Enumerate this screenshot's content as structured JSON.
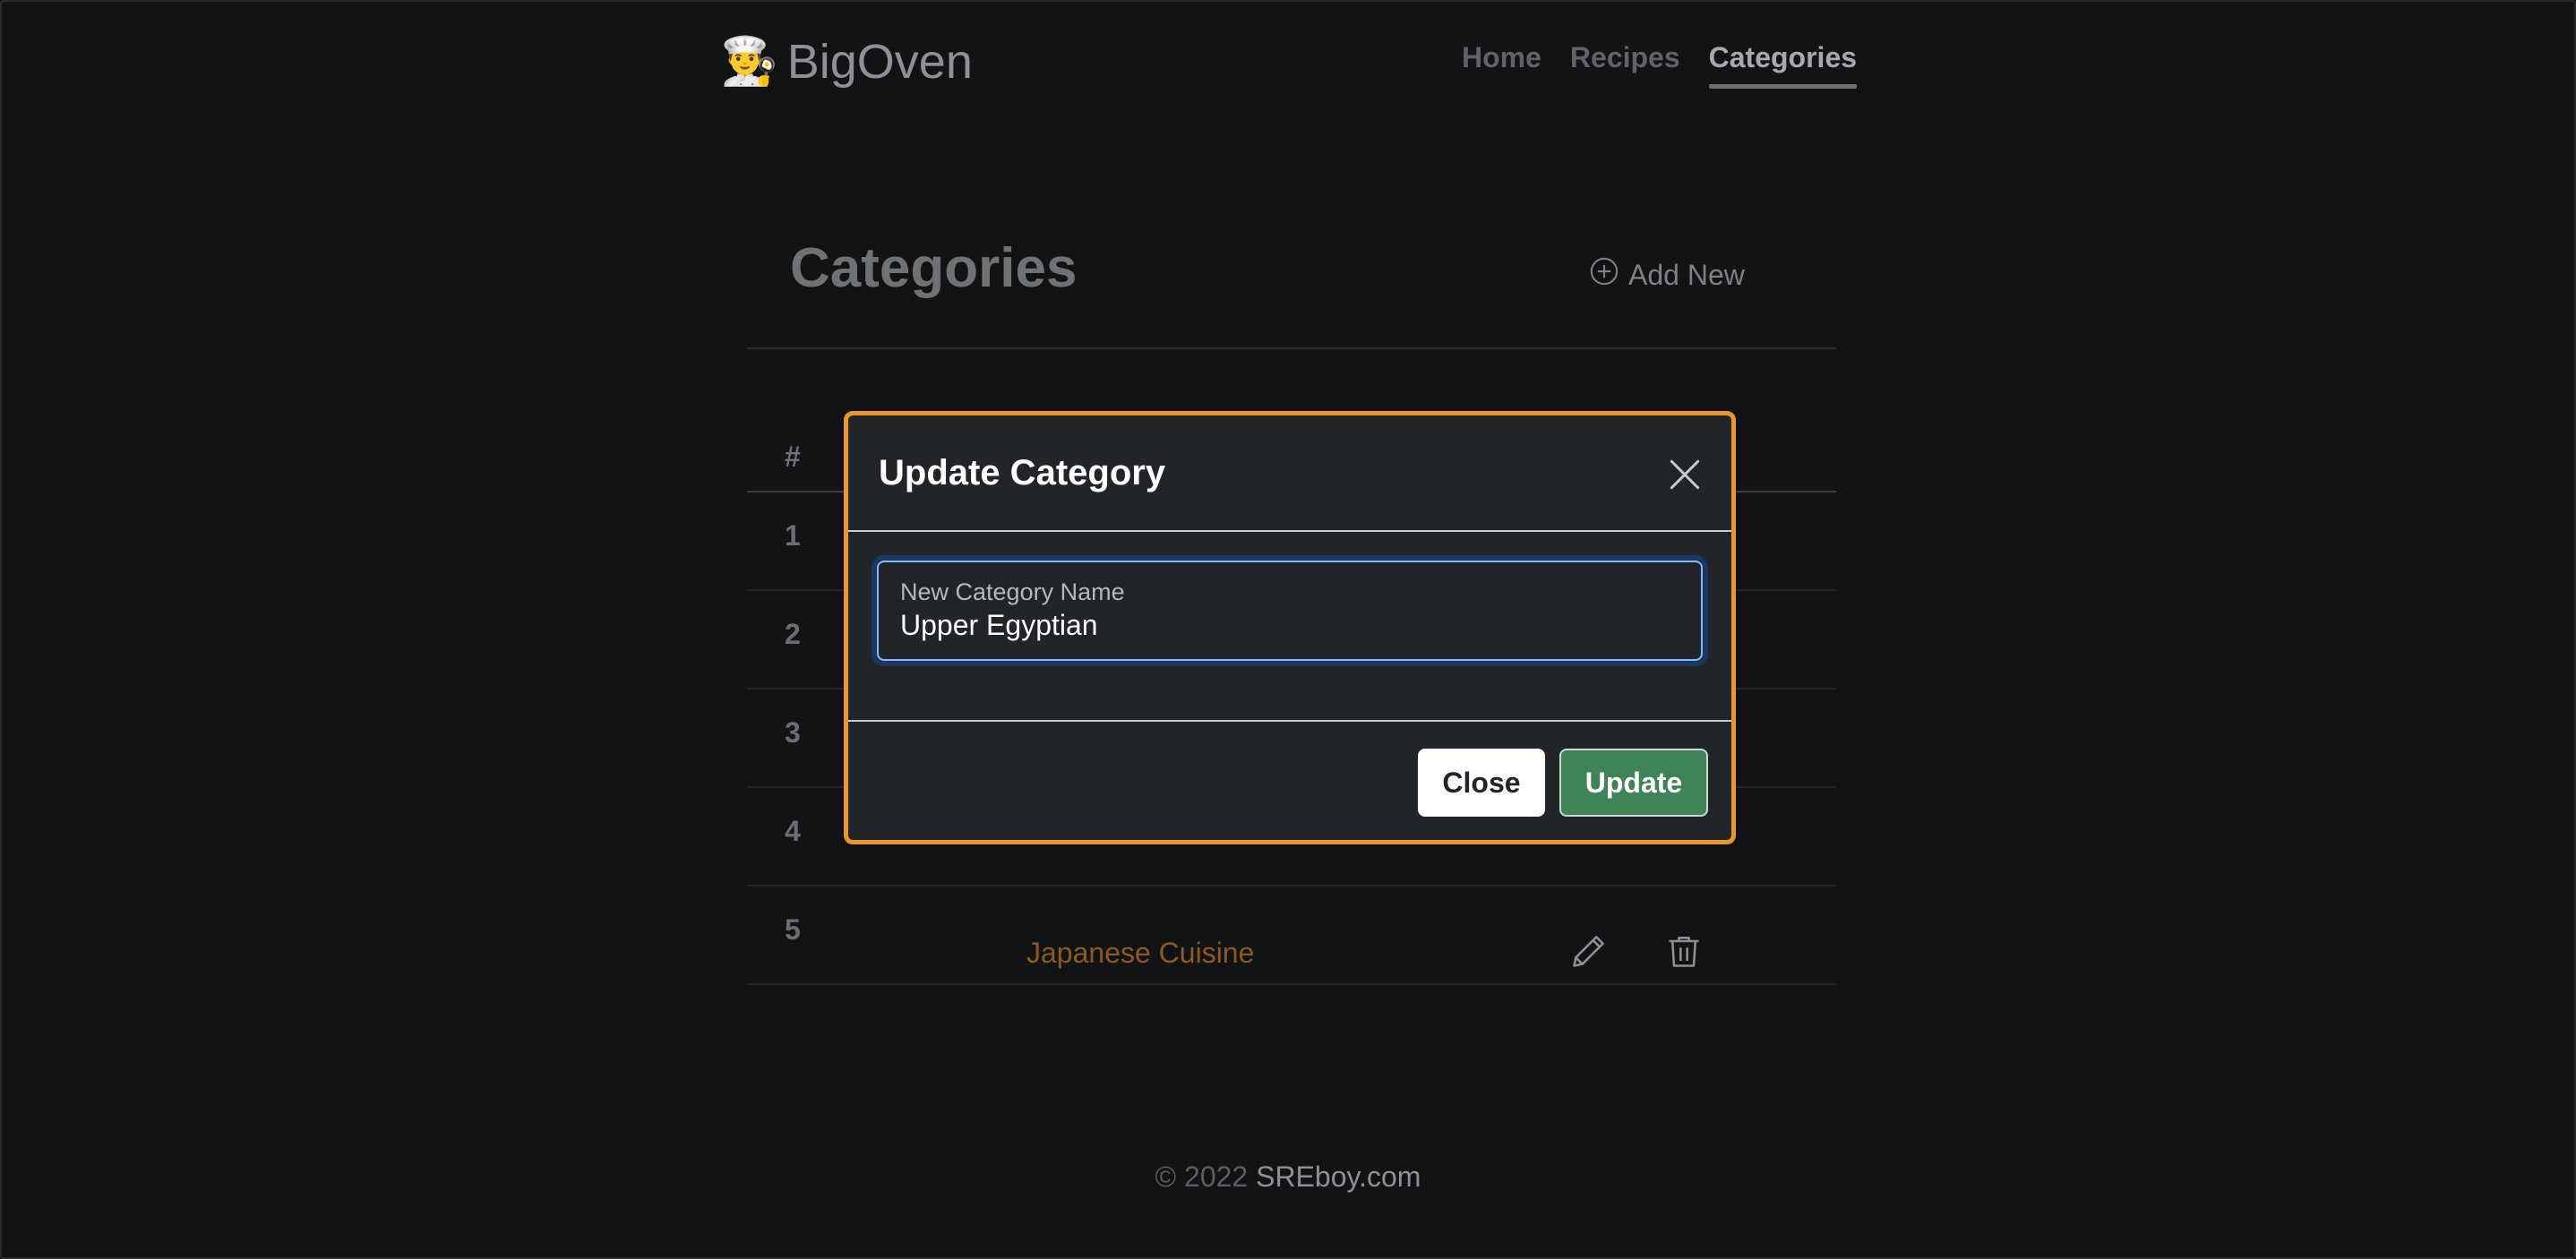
{
  "header": {
    "brand_icon": "👨‍🍳",
    "brand_name": "BigOven",
    "nav": [
      {
        "label": "Home",
        "active": false
      },
      {
        "label": "Recipes",
        "active": false
      },
      {
        "label": "Categories",
        "active": true
      }
    ]
  },
  "page": {
    "title": "Categories",
    "add_new_label": "Add New",
    "table": {
      "columns": [
        "#"
      ],
      "rows": [
        {
          "index": "1",
          "name": ""
        },
        {
          "index": "2",
          "name": ""
        },
        {
          "index": "3",
          "name": ""
        },
        {
          "index": "4",
          "name": ""
        },
        {
          "index": "5",
          "name": "Japanese Cuisine"
        }
      ]
    }
  },
  "modal": {
    "title": "Update Category",
    "field_label": "New Category Name",
    "field_value": "Upper Egyptian",
    "close_label": "Close",
    "update_label": "Update"
  },
  "footer": {
    "copyright": "© 2022",
    "site": "SREboy.com"
  },
  "colors": {
    "modal_border": "#e9962e",
    "update_button": "#3f8456",
    "category_link": "#8a5a22",
    "focus_ring": "#86b7fe"
  },
  "icons": [
    "chef-icon",
    "plus-circle-icon",
    "pencil-icon",
    "trash-icon",
    "close-icon"
  ]
}
